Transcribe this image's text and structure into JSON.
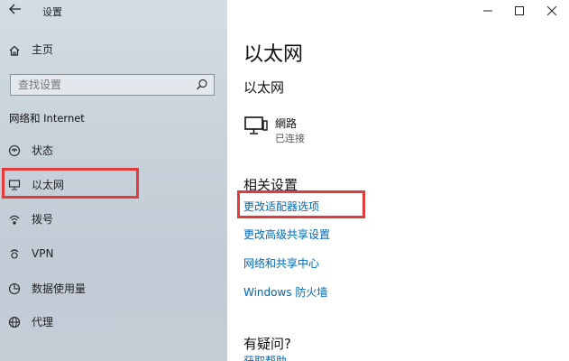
{
  "window": {
    "title": "设置",
    "controls": {
      "minimize": "—",
      "maximize": "☐",
      "close": "✕"
    }
  },
  "sidebar": {
    "home_label": "主页",
    "search": {
      "placeholder": "查找设置",
      "value": ""
    },
    "section_title": "网络和 Internet",
    "items": [
      {
        "label": "状态",
        "icon": "status-icon"
      },
      {
        "label": "以太网",
        "icon": "ethernet-icon",
        "selected": true
      },
      {
        "label": "拨号",
        "icon": "dialup-icon"
      },
      {
        "label": "VPN",
        "icon": "vpn-icon"
      },
      {
        "label": "数据使用量",
        "icon": "data-usage-icon"
      },
      {
        "label": "代理",
        "icon": "proxy-icon"
      }
    ]
  },
  "main": {
    "page_title": "以太网",
    "sub_heading": "以太网",
    "network": {
      "name": "網路",
      "status": "已连接",
      "icon": "monitor-icon"
    },
    "related_heading": "相关设置",
    "links": [
      "更改适配器选项",
      "更改高级共享设置",
      "网络和共享中心",
      "Windows 防火墙"
    ],
    "question_heading": "有疑问?",
    "partial_link": "获取帮助"
  },
  "colors": {
    "accent_link": "#0067b8",
    "highlight_box": "#e23b3b",
    "sidebar_bg": "#c9d3dc"
  }
}
